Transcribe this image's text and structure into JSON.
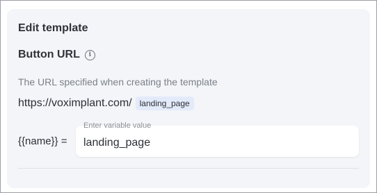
{
  "card": {
    "title": "Edit template"
  },
  "button_url": {
    "label": "Button URL",
    "info_icon": "info-icon",
    "hint": "The URL specified when creating the template",
    "base_url": "https://voximplant.com/",
    "suffix_tag": "landing_page"
  },
  "variable": {
    "name": "{{name}} =",
    "input_label": "Enter variable value",
    "value": "landing_page"
  },
  "colors": {
    "card_bg": "#f4f5f8",
    "tag_bg": "#e3ebfb",
    "hint_text": "#7a8089"
  }
}
